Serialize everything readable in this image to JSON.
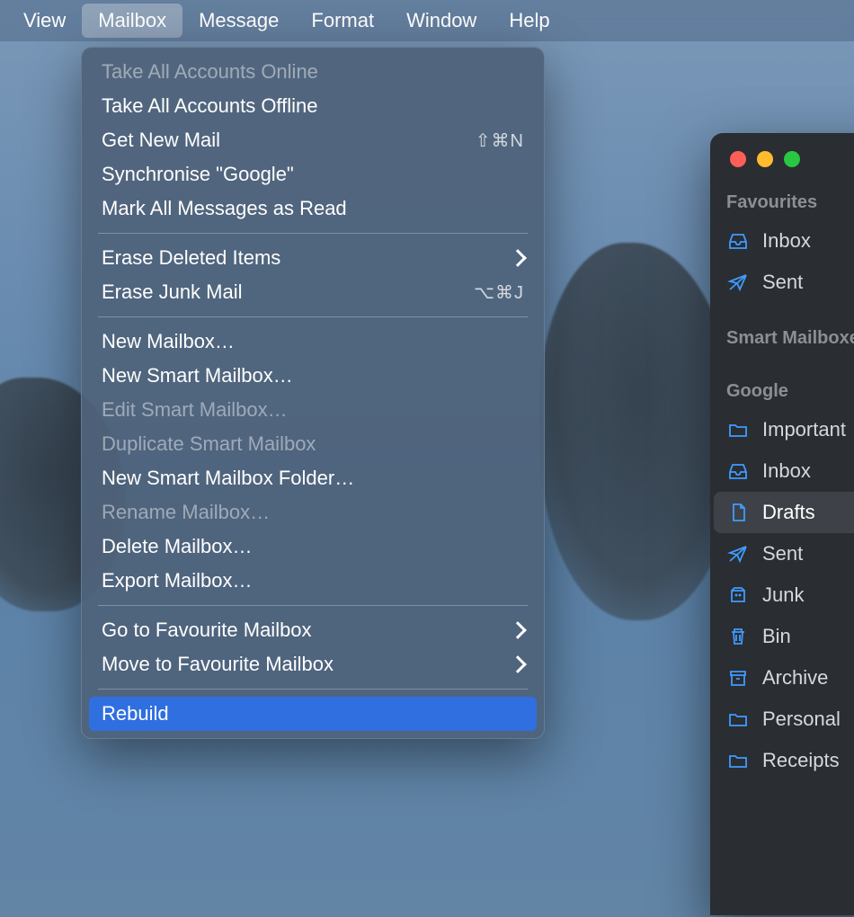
{
  "menubar": {
    "items": [
      {
        "label": "View",
        "active": false
      },
      {
        "label": "Mailbox",
        "active": true
      },
      {
        "label": "Message",
        "active": false
      },
      {
        "label": "Format",
        "active": false
      },
      {
        "label": "Window",
        "active": false
      },
      {
        "label": "Help",
        "active": false
      }
    ]
  },
  "dropdown": {
    "sections": [
      [
        {
          "label": "Take All Accounts Online",
          "disabled": true
        },
        {
          "label": "Take All Accounts Offline"
        },
        {
          "label": "Get New Mail",
          "shortcut": "⇧⌘N"
        },
        {
          "label": "Synchronise \"Google\""
        },
        {
          "label": "Mark All Messages as Read"
        }
      ],
      [
        {
          "label": "Erase Deleted Items",
          "submenu": true
        },
        {
          "label": "Erase Junk Mail",
          "shortcut": "⌥⌘J"
        }
      ],
      [
        {
          "label": "New Mailbox…"
        },
        {
          "label": "New Smart Mailbox…"
        },
        {
          "label": "Edit Smart Mailbox…",
          "disabled": true
        },
        {
          "label": "Duplicate Smart Mailbox",
          "disabled": true
        },
        {
          "label": "New Smart Mailbox Folder…"
        },
        {
          "label": "Rename Mailbox…",
          "disabled": true
        },
        {
          "label": "Delete Mailbox…"
        },
        {
          "label": "Export Mailbox…"
        }
      ],
      [
        {
          "label": "Go to Favourite Mailbox",
          "submenu": true
        },
        {
          "label": "Move to Favourite Mailbox",
          "submenu": true
        }
      ],
      [
        {
          "label": "Rebuild",
          "highlight": true
        }
      ]
    ]
  },
  "sidebar": {
    "sections": [
      {
        "header": "Favourites",
        "items": [
          {
            "icon": "inbox",
            "label": "Inbox"
          },
          {
            "icon": "sent",
            "label": "Sent"
          }
        ]
      },
      {
        "header": "Smart Mailboxes",
        "items": []
      },
      {
        "header": "Google",
        "items": [
          {
            "icon": "folder",
            "label": "Important"
          },
          {
            "icon": "inbox",
            "label": "Inbox"
          },
          {
            "icon": "doc",
            "label": "Drafts",
            "selected": true
          },
          {
            "icon": "sent",
            "label": "Sent"
          },
          {
            "icon": "junk",
            "label": "Junk"
          },
          {
            "icon": "trash",
            "label": "Bin"
          },
          {
            "icon": "archive",
            "label": "Archive"
          },
          {
            "icon": "folder",
            "label": "Personal"
          },
          {
            "icon": "folder",
            "label": "Receipts"
          }
        ]
      }
    ]
  }
}
